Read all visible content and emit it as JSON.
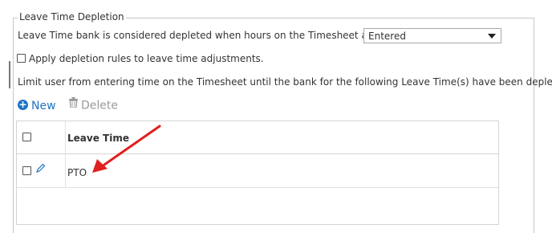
{
  "section": {
    "legend": "Leave Time Depletion",
    "depletion_label": "Leave Time bank is considered depleted when hours on the Timesheet are:",
    "depletion_select": {
      "value": "Entered"
    },
    "adjustments_label": "Apply depletion rules to leave time adjustments.",
    "adjustments_checked": false,
    "limit_text": "Limit user from entering time on the Timesheet until the bank for the following Leave Time(s) have been depleted."
  },
  "toolbar": {
    "new_label": "New",
    "delete_label": "Delete"
  },
  "grid": {
    "column_header": "Leave Time",
    "rows": [
      {
        "leave_time": "PTO",
        "checked": false
      }
    ]
  },
  "annotation": {
    "arrow_color": "#e01f1f"
  },
  "colors": {
    "accent": "#1f74c6",
    "disabled": "#9a9a9a"
  }
}
